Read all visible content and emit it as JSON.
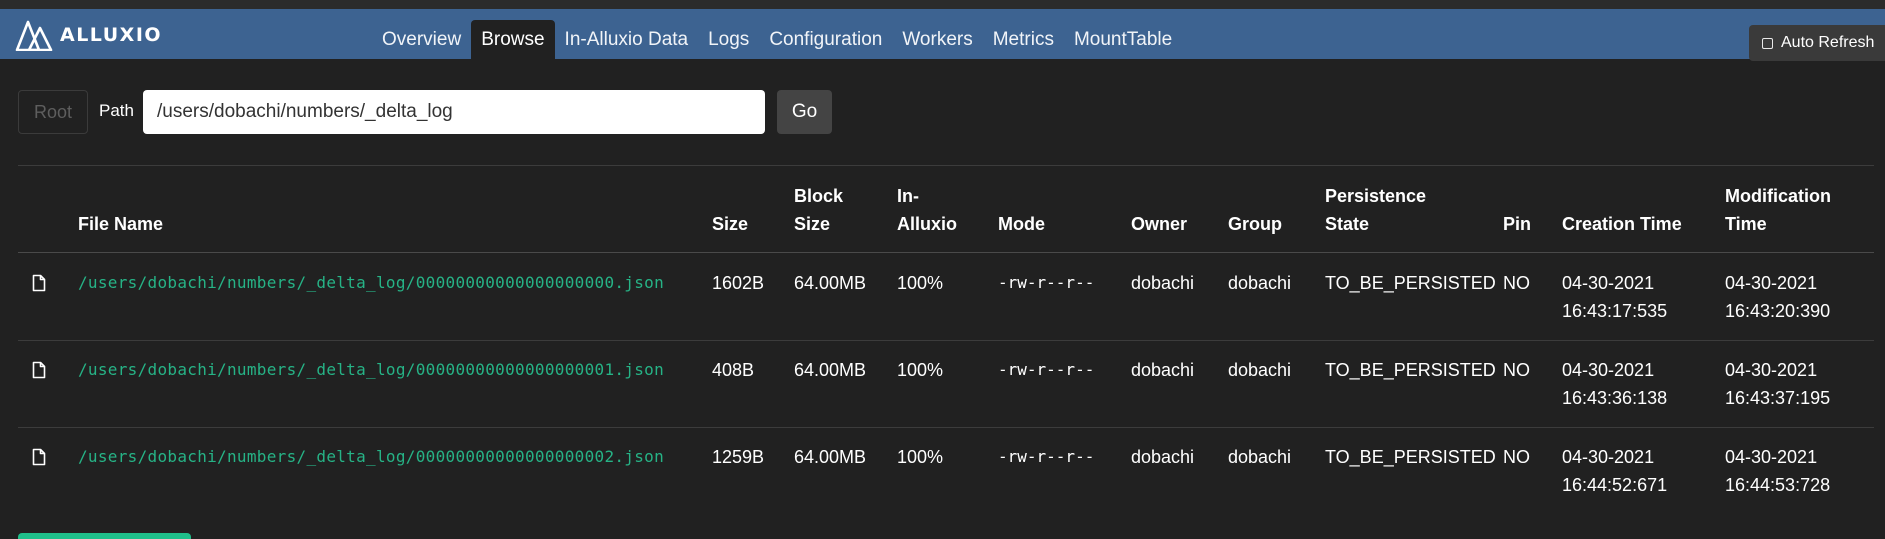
{
  "app": {
    "brand": "ALLUXIO"
  },
  "nav": {
    "items": [
      "Overview",
      "Browse",
      "In-Alluxio Data",
      "Logs",
      "Configuration",
      "Workers",
      "Metrics",
      "MountTable"
    ],
    "active": "Browse"
  },
  "auto_refresh": {
    "label": "Auto Refresh",
    "checked": false
  },
  "path_bar": {
    "root_label": "Root",
    "path_label": "Path",
    "path_value": "/users/dobachi/numbers/_delta_log",
    "go_label": "Go"
  },
  "table": {
    "headers": {
      "file_name": "File Name",
      "size": "Size",
      "block_size_1": "Block",
      "block_size_2": "Size",
      "in_alluxio_1": "In-",
      "in_alluxio_2": "Alluxio",
      "mode": "Mode",
      "owner": "Owner",
      "group": "Group",
      "persistence_1": "Persistence",
      "persistence_2": "State",
      "pin": "Pin",
      "creation": "Creation Time",
      "modification_1": "Modification",
      "modification_2": "Time"
    },
    "rows": [
      {
        "icon": "file-icon",
        "file_name": "/users/dobachi/numbers/_delta_log/00000000000000000000.json",
        "size": "1602B",
        "block_size": "64.00MB",
        "in_alluxio": "100%",
        "mode": "-rw-r--r--",
        "owner": "dobachi",
        "group": "dobachi",
        "persistence": "TO_BE_PERSISTED",
        "pin": "NO",
        "created_date": "04-30-2021",
        "created_time": "16:43:17:535",
        "modified_date": "04-30-2021",
        "modified_time": "16:43:20:390"
      },
      {
        "icon": "file-icon",
        "file_name": "/users/dobachi/numbers/_delta_log/00000000000000000001.json",
        "size": "408B",
        "block_size": "64.00MB",
        "in_alluxio": "100%",
        "mode": "-rw-r--r--",
        "owner": "dobachi",
        "group": "dobachi",
        "persistence": "TO_BE_PERSISTED",
        "pin": "NO",
        "created_date": "04-30-2021",
        "created_time": "16:43:36:138",
        "modified_date": "04-30-2021",
        "modified_time": "16:43:37:195"
      },
      {
        "icon": "file-icon",
        "file_name": "/users/dobachi/numbers/_delta_log/00000000000000000002.json",
        "size": "1259B",
        "block_size": "64.00MB",
        "in_alluxio": "100%",
        "mode": "-rw-r--r--",
        "owner": "dobachi",
        "group": "dobachi",
        "persistence": "TO_BE_PERSISTED",
        "pin": "NO",
        "created_date": "04-30-2021",
        "created_time": "16:44:52:671",
        "modified_date": "04-30-2021",
        "modified_time": "16:44:53:728"
      }
    ]
  },
  "colors": {
    "navbar": "#3d6391",
    "background": "#212121",
    "link": "#26b386"
  }
}
